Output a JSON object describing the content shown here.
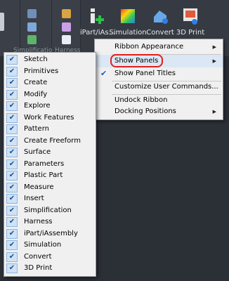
{
  "ribbon": {
    "groups": [
      "Simplification",
      "Harness"
    ],
    "commands": [
      {
        "label": "iPart/iAs...",
        "icon": "ipart-icon"
      },
      {
        "label": "Simulation",
        "icon": "simulation-icon"
      },
      {
        "label": "Convert",
        "icon": "convert-icon"
      },
      {
        "label": "3D Print",
        "icon": "3d-print-icon"
      }
    ]
  },
  "context_menu": {
    "items": [
      {
        "label": "Ribbon Appearance",
        "has_submenu": true,
        "checked": false
      },
      {
        "label": "Show Panels",
        "has_submenu": true,
        "checked": false,
        "highlighted": true
      },
      {
        "label": "Show Panel Titles",
        "has_submenu": false,
        "checked": true
      },
      {
        "label": "Customize User Commands...",
        "has_submenu": false,
        "checked": false
      },
      {
        "label": "Undock Ribbon",
        "has_submenu": false,
        "checked": false
      },
      {
        "label": "Docking Positions",
        "has_submenu": true,
        "checked": false
      }
    ],
    "arrow_glyph": "▶",
    "check_glyph": "✔"
  },
  "panels_submenu": {
    "check_glyph": "✔",
    "items": [
      {
        "label": "Sketch",
        "checked": true
      },
      {
        "label": "Primitives",
        "checked": true
      },
      {
        "label": "Create",
        "checked": true
      },
      {
        "label": "Modify",
        "checked": true
      },
      {
        "label": "Explore",
        "checked": true
      },
      {
        "label": "Work Features",
        "checked": true
      },
      {
        "label": "Pattern",
        "checked": true
      },
      {
        "label": "Create Freeform",
        "checked": true
      },
      {
        "label": "Surface",
        "checked": true
      },
      {
        "label": "Parameters",
        "checked": true
      },
      {
        "label": "Plastic Part",
        "checked": true
      },
      {
        "label": "Measure",
        "checked": true
      },
      {
        "label": "Insert",
        "checked": true
      },
      {
        "label": "Simplification",
        "checked": true
      },
      {
        "label": "Harness",
        "checked": true
      },
      {
        "label": "iPart/iAssembly",
        "checked": true
      },
      {
        "label": "Simulation",
        "checked": true
      },
      {
        "label": "Convert",
        "checked": true
      },
      {
        "label": "3D Print",
        "checked": true
      }
    ]
  },
  "colors": {
    "ribbon_bg": "#363b43",
    "menu_bg": "#f0f0f0",
    "highlight_oval": "#e0201a",
    "check_box_bg": "#cfe2f6"
  }
}
